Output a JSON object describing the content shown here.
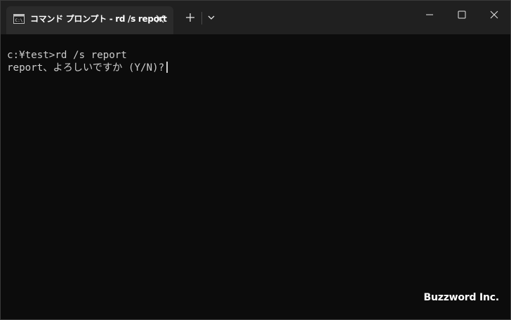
{
  "tab": {
    "icon": "cmd-icon",
    "title": "コマンド プロンプト - rd  /s report",
    "close_icon": "close-icon"
  },
  "titlebar": {
    "new_tab_icon": "plus-icon",
    "dropdown_icon": "chevron-down-icon",
    "minimize_icon": "minimize-icon",
    "maximize_icon": "maximize-icon",
    "close_icon": "close-icon"
  },
  "terminal": {
    "lines": [
      "c:¥test>rd /s report",
      "report、よろしいですか (Y/N)?"
    ]
  },
  "watermark": "Buzzword Inc.",
  "colors": {
    "background": "#0c0c0c",
    "titlebar": "#202020",
    "tab": "#2b2b2b",
    "text": "#cccccc"
  }
}
